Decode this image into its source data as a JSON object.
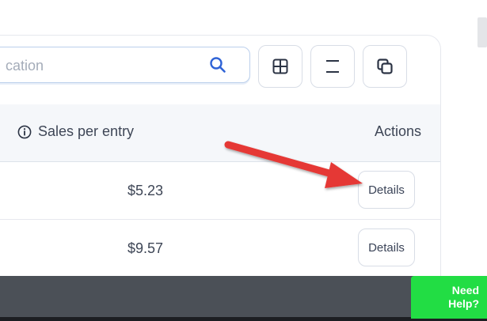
{
  "search": {
    "placeholder": "cation"
  },
  "toolbar": {
    "buttons": [
      "table-columns-icon",
      "density-icon",
      "copy-icon"
    ]
  },
  "table": {
    "headers": {
      "sales": "Sales per entry",
      "actions": "Actions"
    },
    "rows": [
      {
        "sales": "$5.23",
        "action": "Details"
      },
      {
        "sales": "$9.57",
        "action": "Details"
      }
    ]
  },
  "help": {
    "line1": "Need",
    "line2": "Help?"
  },
  "colors": {
    "accent": "#2f63d6",
    "help_green": "#22dd44",
    "annotation_arrow": "#e53935",
    "footer": "#4b5057"
  }
}
